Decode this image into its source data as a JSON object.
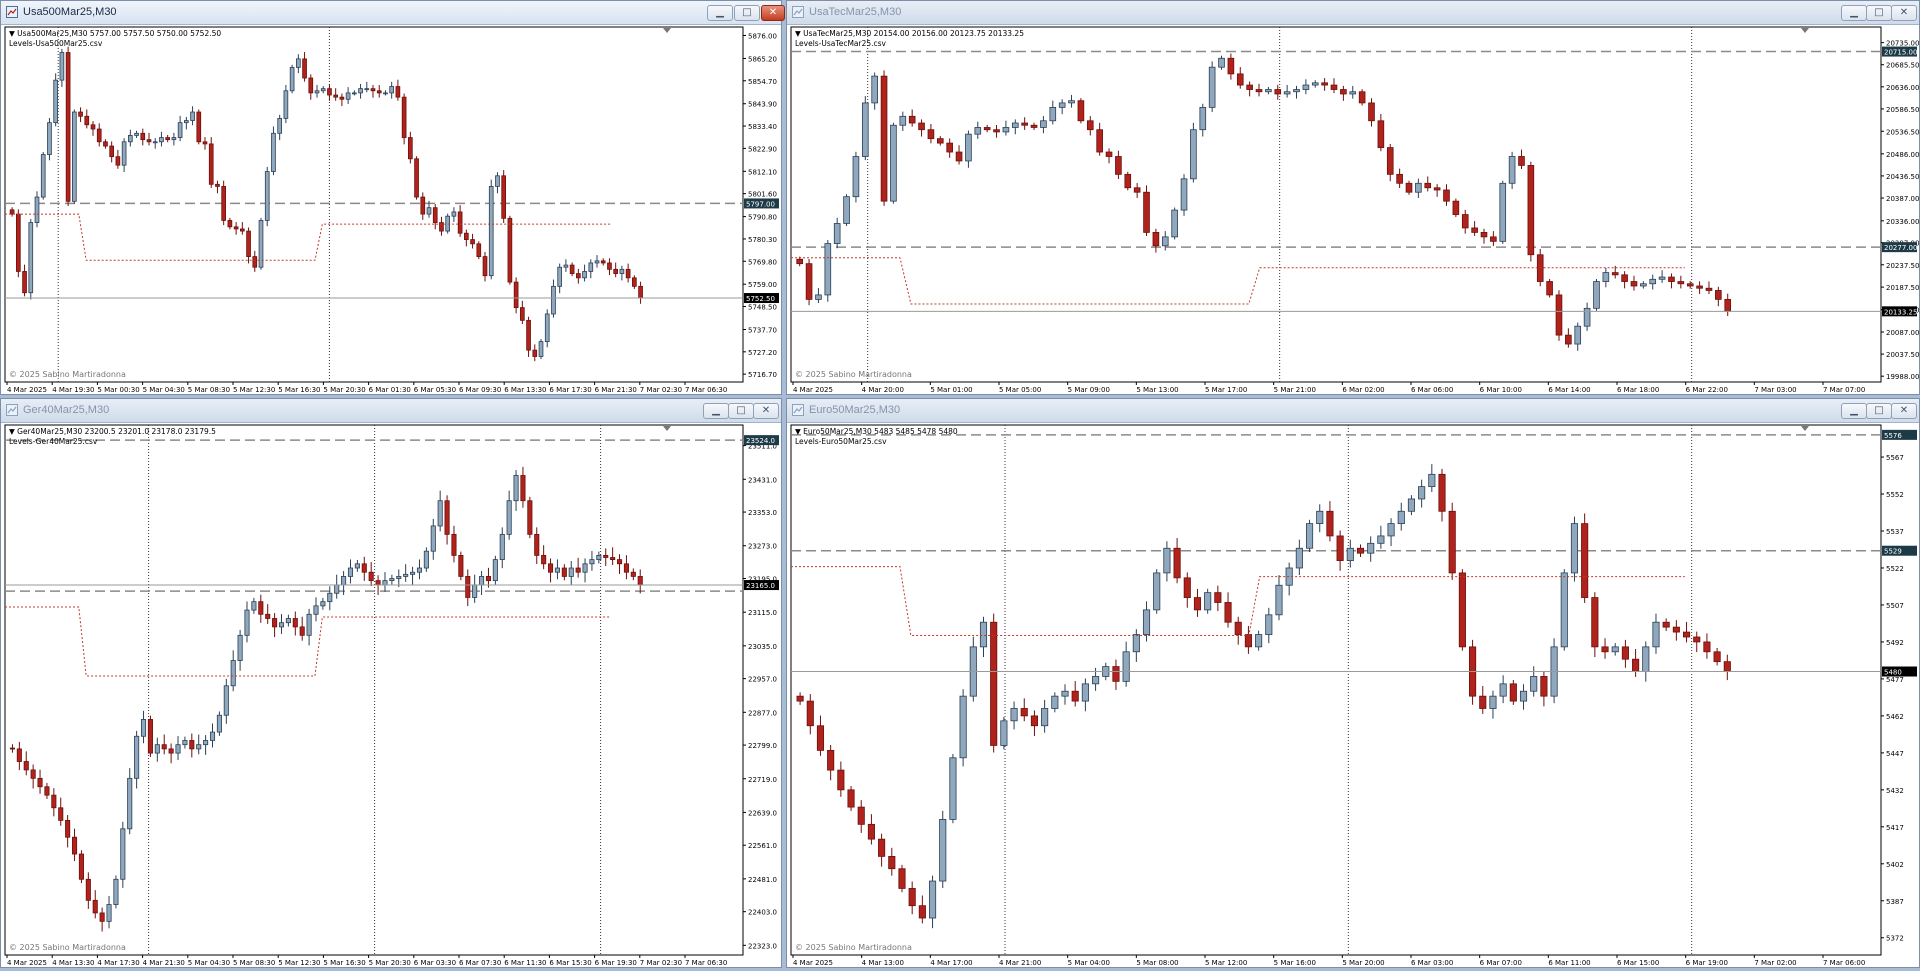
{
  "charts": [
    {
      "window_title": "Usa500Mar25,M30",
      "active": true,
      "ohlc_label": "Usa500Mar25,M30  5757.00 5757.50 5750.00 5752.50",
      "indicator_label": "Levels-Usa500Mar25.csv",
      "copyright": "© 2025 Sabino Martiradonna",
      "price_marker": "5752.50",
      "level_marker": "5797.00",
      "chart_data": {
        "type": "candlestick",
        "symbol": "Usa500Mar25",
        "timeframe": "M30",
        "ylim": [
          5713,
          5880
        ],
        "yticks": [
          "5876.00",
          "5865.20",
          "5854.70",
          "5843.90",
          "5833.40",
          "5822.90",
          "5812.10",
          "5801.60",
          "5790.80",
          "5780.30",
          "5769.80",
          "5759.00",
          "5748.50",
          "5737.70",
          "5727.20",
          "5716.70"
        ],
        "xticks": [
          "4 Mar 2025",
          "4 Mar 19:30",
          "5 Mar 00:30",
          "5 Mar 04:30",
          "5 Mar 08:30",
          "5 Mar 12:30",
          "5 Mar 16:30",
          "5 Mar 20:30",
          "6 Mar 01:30",
          "6 Mar 05:30",
          "6 Mar 09:30",
          "6 Mar 13:30",
          "6 Mar 17:30",
          "6 Mar 21:30",
          "7 Mar 02:30",
          "7 Mar 06:30"
        ],
        "current_price": 5752.5,
        "level_lines": [
          5797.0
        ],
        "closes": [
          5792,
          5765,
          5755,
          5788,
          5800,
          5820,
          5835,
          5855,
          5868,
          5798,
          5840,
          5838,
          5834,
          5832,
          5826,
          5824,
          5819,
          5815,
          5826,
          5829,
          5830,
          5827,
          5826,
          5826,
          5828,
          5827,
          5828,
          5835,
          5836,
          5840,
          5826,
          5825,
          5806,
          5805,
          5789,
          5786,
          5785,
          5784,
          5772,
          5767,
          5789,
          5812,
          5830,
          5837,
          5850,
          5861,
          5865,
          5856,
          5849,
          5850,
          5851,
          5848,
          5847,
          5846,
          5849,
          5849,
          5851,
          5851,
          5850,
          5849,
          5849,
          5852,
          5847,
          5828,
          5818,
          5800,
          5792,
          5795,
          5788,
          5784,
          5791,
          5793,
          5783,
          5780,
          5778,
          5772,
          5763,
          5805,
          5810,
          5790,
          5760,
          5748,
          5742,
          5728,
          5725,
          5732,
          5745,
          5758,
          5767,
          5768,
          5764,
          5762,
          5765,
          5769,
          5770,
          5769,
          5766,
          5764,
          5766,
          5762,
          5758,
          5752.5
        ]
      },
      "vlines": [
        "4 Mar 19:30",
        "5 Mar 20:30",
        "6 Mar 19:30"
      ]
    },
    {
      "window_title": "UsaTecMar25,M30",
      "active": false,
      "ohlc_label": "UsaTecMar25,M30  20154.00 20156.00 20123.75 20133.25",
      "indicator_label": "Levels-UsaTecMar25.csv",
      "copyright": "© 2025 Sabino Martiradonna",
      "price_marker": "20133.25",
      "level_marker": "20715.00",
      "level_marker_2": "20277.00",
      "chart_data": {
        "type": "candlestick",
        "symbol": "UsaTecMar25",
        "timeframe": "M30",
        "ylim": [
          19975,
          20770
        ],
        "yticks": [
          "20735.00",
          "20685.50",
          "20636.00",
          "20586.50",
          "20536.50",
          "20486.00",
          "20436.50",
          "20387.00",
          "20336.00",
          "20287.00",
          "20237.50",
          "20187.50",
          "20137.00",
          "20087.00",
          "20037.50",
          "19988.00"
        ],
        "xticks": [
          "4 Mar 2025",
          "4 Mar 20:00",
          "5 Mar 01:00",
          "5 Mar 05:00",
          "5 Mar 09:00",
          "5 Mar 13:00",
          "5 Mar 17:00",
          "5 Mar 21:00",
          "6 Mar 02:00",
          "6 Mar 06:00",
          "6 Mar 10:00",
          "6 Mar 14:00",
          "6 Mar 18:00",
          "6 Mar 22:00",
          "7 Mar 03:00",
          "7 Mar 07:00"
        ],
        "current_price": 20133.25,
        "level_lines": [
          20715.0,
          20277.0
        ],
        "closes": [
          20240,
          20160,
          20170,
          20285,
          20330,
          20390,
          20480,
          20600,
          20660,
          20380,
          20550,
          20570,
          20555,
          20540,
          20520,
          20510,
          20490,
          20470,
          20530,
          20545,
          20540,
          20535,
          20545,
          20555,
          20550,
          20545,
          20560,
          20590,
          20600,
          20605,
          20560,
          20540,
          20490,
          20480,
          20440,
          20410,
          20400,
          20310,
          20280,
          20300,
          20360,
          20430,
          20540,
          20590,
          20680,
          20700,
          20665,
          20640,
          20630,
          20625,
          20630,
          20620,
          20625,
          20630,
          20640,
          20645,
          20640,
          20630,
          20620,
          20625,
          20600,
          20560,
          20500,
          20440,
          20420,
          20400,
          20420,
          20410,
          20405,
          20380,
          20350,
          20320,
          20310,
          20300,
          20290,
          20420,
          20480,
          20460,
          20260,
          20200,
          20170,
          20080,
          20060,
          20100,
          20140,
          20200,
          20220,
          20215,
          20200,
          20190,
          20195,
          20205,
          20210,
          20200,
          20195,
          20190,
          20185,
          20180,
          20160,
          20133.25
        ]
      },
      "vlines": [
        "4 Mar 20:00",
        "5 Mar 21:00",
        "6 Mar 22:00"
      ]
    },
    {
      "window_title": "Ger40Mar25,M30",
      "active": false,
      "ohlc_label": "Ger40Mar25,M30  23200.5 23201.0 23178.0 23179.5",
      "indicator_label": "Levels-Ger40Mar25.csv",
      "copyright": "© 2025 Sabino Martiradonna",
      "price_marker": "23165.0",
      "level_marker": "23524.0",
      "chart_data": {
        "type": "candlestick",
        "symbol": "Ger40Mar25",
        "timeframe": "M30",
        "ylim": [
          22300,
          23560
        ],
        "yticks": [
          "23511.0",
          "23431.0",
          "23353.0",
          "23273.0",
          "23195.0",
          "23115.0",
          "23035.0",
          "22957.0",
          "22877.0",
          "22799.0",
          "22719.0",
          "22639.0",
          "22561.0",
          "22481.0",
          "22403.0",
          "22323.0"
        ],
        "xticks": [
          "4 Mar 2025",
          "4 Mar 13:30",
          "4 Mar 17:30",
          "4 Mar 21:30",
          "5 Mar 04:30",
          "5 Mar 08:30",
          "5 Mar 12:30",
          "5 Mar 16:30",
          "5 Mar 20:30",
          "6 Mar 03:30",
          "6 Mar 07:30",
          "6 Mar 11:30",
          "6 Mar 15:30",
          "6 Mar 19:30",
          "7 Mar 02:30",
          "7 Mar 06:30"
        ],
        "current_price": 23179.5,
        "level_lines": [
          23524.0,
          23165.0
        ],
        "closes": [
          22790,
          22760,
          22740,
          22720,
          22700,
          22680,
          22650,
          22620,
          22580,
          22540,
          22480,
          22430,
          22400,
          22380,
          22420,
          22480,
          22600,
          22720,
          22820,
          22860,
          22780,
          22800,
          22790,
          22780,
          22800,
          22810,
          22790,
          22800,
          22810,
          22830,
          22870,
          22940,
          23000,
          23060,
          23120,
          23140,
          23110,
          23100,
          23080,
          23090,
          23100,
          23080,
          23060,
          23110,
          23130,
          23140,
          23160,
          23180,
          23200,
          23220,
          23230,
          23210,
          23190,
          23180,
          23190,
          23195,
          23200,
          23205,
          23210,
          23220,
          23260,
          23320,
          23380,
          23300,
          23250,
          23200,
          23150,
          23180,
          23200,
          23190,
          23240,
          23300,
          23380,
          23440,
          23380,
          23300,
          23250,
          23230,
          23210,
          23220,
          23200,
          23220,
          23210,
          23230,
          23240,
          23250,
          23245,
          23240,
          23230,
          23210,
          23200,
          23180
        ]
      },
      "vlines": [
        "4 Mar 21:30",
        "5 Mar 20:30",
        "6 Mar 19:30"
      ]
    },
    {
      "window_title": "Euro50Mar25,M30",
      "active": false,
      "ohlc_label": "Euro50Mar25,M30  5483 5485 5478 5480",
      "indicator_label": "Levels-Euro50Mar25.csv",
      "copyright": "© 2025 Sabino Martiradonna",
      "price_marker": "5480",
      "level_marker": "5576",
      "level_marker_2": "5529",
      "chart_data": {
        "type": "candlestick",
        "symbol": "Euro50Mar25",
        "timeframe": "M30",
        "ylim": [
          5365,
          5580
        ],
        "yticks": [
          "5567",
          "5552",
          "5537",
          "5522",
          "5507",
          "5492",
          "5477",
          "5462",
          "5447",
          "5432",
          "5417",
          "5402",
          "5387",
          "5372"
        ],
        "xticks": [
          "4 Mar 2025",
          "4 Mar 13:00",
          "4 Mar 17:00",
          "4 Mar 21:00",
          "5 Mar 04:00",
          "5 Mar 08:00",
          "5 Mar 12:00",
          "5 Mar 16:00",
          "5 Mar 20:00",
          "6 Mar 03:00",
          "6 Mar 07:00",
          "6 Mar 11:00",
          "6 Mar 15:00",
          "6 Mar 19:00",
          "7 Mar 02:00",
          "7 Mar 06:00"
        ],
        "current_price": 5480,
        "level_lines": [
          5576,
          5529
        ],
        "closes": [
          5468,
          5458,
          5448,
          5440,
          5432,
          5425,
          5418,
          5412,
          5405,
          5400,
          5392,
          5385,
          5380,
          5395,
          5420,
          5445,
          5470,
          5490,
          5500,
          5450,
          5460,
          5465,
          5462,
          5458,
          5465,
          5470,
          5472,
          5468,
          5475,
          5478,
          5482,
          5476,
          5488,
          5495,
          5505,
          5520,
          5530,
          5518,
          5510,
          5505,
          5512,
          5508,
          5500,
          5495,
          5490,
          5495,
          5503,
          5515,
          5522,
          5530,
          5540,
          5545,
          5535,
          5525,
          5530,
          5528,
          5532,
          5535,
          5540,
          5545,
          5550,
          5555,
          5560,
          5545,
          5520,
          5490,
          5470,
          5465,
          5470,
          5475,
          5468,
          5472,
          5478,
          5470,
          5490,
          5520,
          5540,
          5510,
          5490,
          5488,
          5490,
          5485,
          5480,
          5490,
          5500,
          5498,
          5496,
          5494,
          5492,
          5488,
          5484,
          5480
        ]
      },
      "vlines": [
        "4 Mar 21:00",
        "5 Mar 20:00",
        "6 Mar 19:00"
      ]
    }
  ],
  "colors": {
    "bull_fill": "#8fa8be",
    "bull_border": "#2b3f55",
    "bear_fill": "#b0231d",
    "bear_border": "#6d0f0b",
    "grid_dash": "#555555",
    "level_line": "#8a8a8a",
    "level_box": "#c0392b",
    "marker_bg": "#1d3a47",
    "price_marker_bg": "#000000"
  },
  "window_buttons": {
    "minimize": "▁",
    "maximize": "□",
    "close": "✕"
  }
}
